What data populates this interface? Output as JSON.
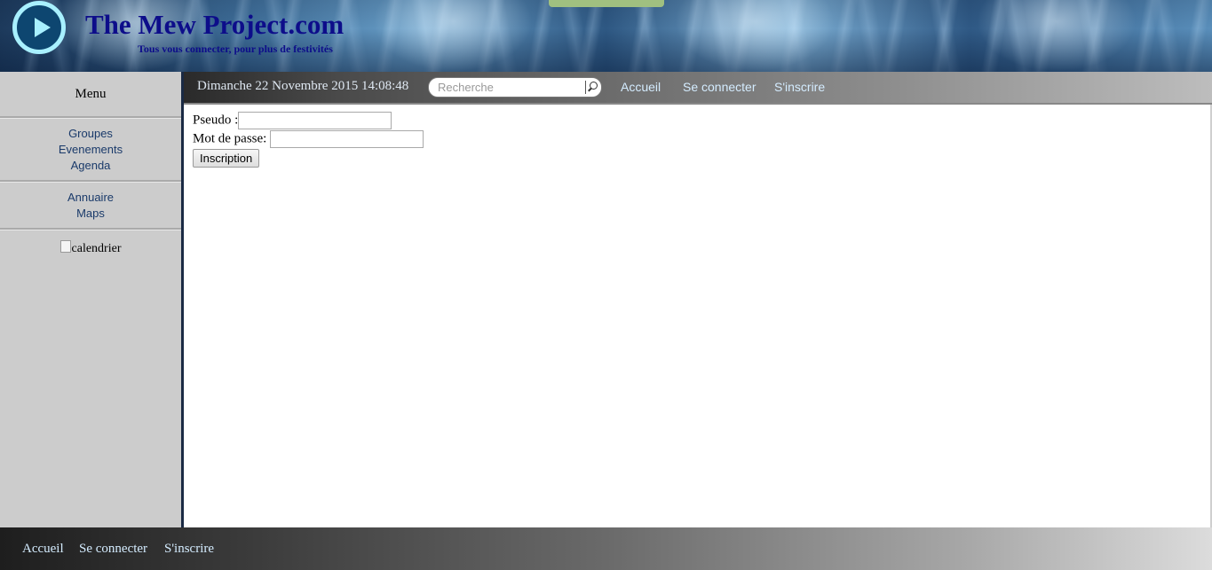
{
  "header": {
    "title": "The Mew Project.com",
    "subtitle": "Tous vous connecter, pour plus de festivités"
  },
  "sidebar": {
    "menu_title": "Menu",
    "group1": [
      "Groupes",
      "Evenements",
      "Agenda"
    ],
    "group2": [
      "Annuaire",
      "Maps"
    ],
    "calendar_alt": "calendrier"
  },
  "navbar": {
    "date": "Dimanche 22 Novembre 2015 14:08:48",
    "search_placeholder": "Recherche",
    "links": [
      "Accueil",
      "Se connecter",
      "S'inscrire"
    ]
  },
  "form": {
    "pseudo_label": "Pseudo :",
    "pseudo_value": "",
    "password_label": "Mot de passe:",
    "password_value": "",
    "submit_label": "Inscription"
  },
  "footer": {
    "links": [
      "Accueil",
      "Se connecter",
      "S'inscrire"
    ]
  },
  "colors": {
    "title": "#0d0d8a",
    "nav_link": "#d4ecff",
    "sidebar_link": "#1a3a6a",
    "logo_ring": "#a8f0ff"
  },
  "icons": {
    "logo": "play-circle-icon",
    "search": "magnifier-icon",
    "broken_image": "broken-image-icon"
  }
}
